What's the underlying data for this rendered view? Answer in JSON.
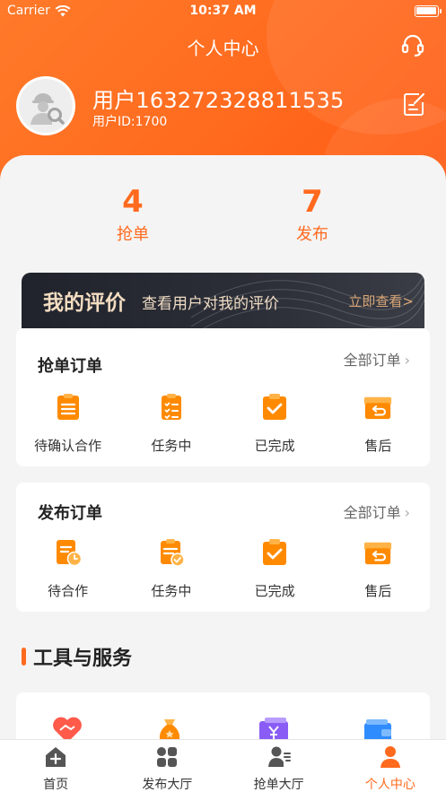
{
  "status_bar": {
    "carrier": "Carrier",
    "time": "10:37 AM",
    "battery_level": 1.0
  },
  "header": {
    "title": "个人中心"
  },
  "profile": {
    "name": "用户163272328811535",
    "id_label": "用户ID:1700"
  },
  "stats": [
    {
      "value": "4",
      "label": "抢单"
    },
    {
      "value": "7",
      "label": "发布"
    }
  ],
  "review_banner": {
    "title": "我的评价",
    "subtitle": "查看用户对我的评价",
    "link": "立即查看>"
  },
  "grab_orders": {
    "title": "抢单订单",
    "all_label": "全部订单",
    "items": [
      {
        "label": "待确认合作",
        "icon": "list-doc-icon"
      },
      {
        "label": "任务中",
        "icon": "checklist-icon"
      },
      {
        "label": "已完成",
        "icon": "clipboard-check-icon"
      },
      {
        "label": "售后",
        "icon": "return-box-icon"
      }
    ]
  },
  "publish_orders": {
    "title": "发布订单",
    "all_label": "全部订单",
    "items": [
      {
        "label": "待合作",
        "icon": "doc-clock-icon"
      },
      {
        "label": "任务中",
        "icon": "doc-check-badge-icon"
      },
      {
        "label": "已完成",
        "icon": "clipboard-check-icon"
      },
      {
        "label": "售后",
        "icon": "return-box-icon"
      }
    ]
  },
  "tools_section": {
    "title": "工具与服务"
  },
  "tabs": [
    {
      "label": "首页",
      "icon": "home-plus-icon",
      "active": false
    },
    {
      "label": "发布大厅",
      "icon": "grid-apps-icon",
      "active": false
    },
    {
      "label": "抢单大厅",
      "icon": "user-list-icon",
      "active": false
    },
    {
      "label": "个人中心",
      "icon": "person-icon",
      "active": true
    }
  ],
  "colors": {
    "accent": "#ff6a1e",
    "banner_dark": "#20232c",
    "banner_gold": "#d9a676",
    "icon_orange": "#ff8a00"
  }
}
